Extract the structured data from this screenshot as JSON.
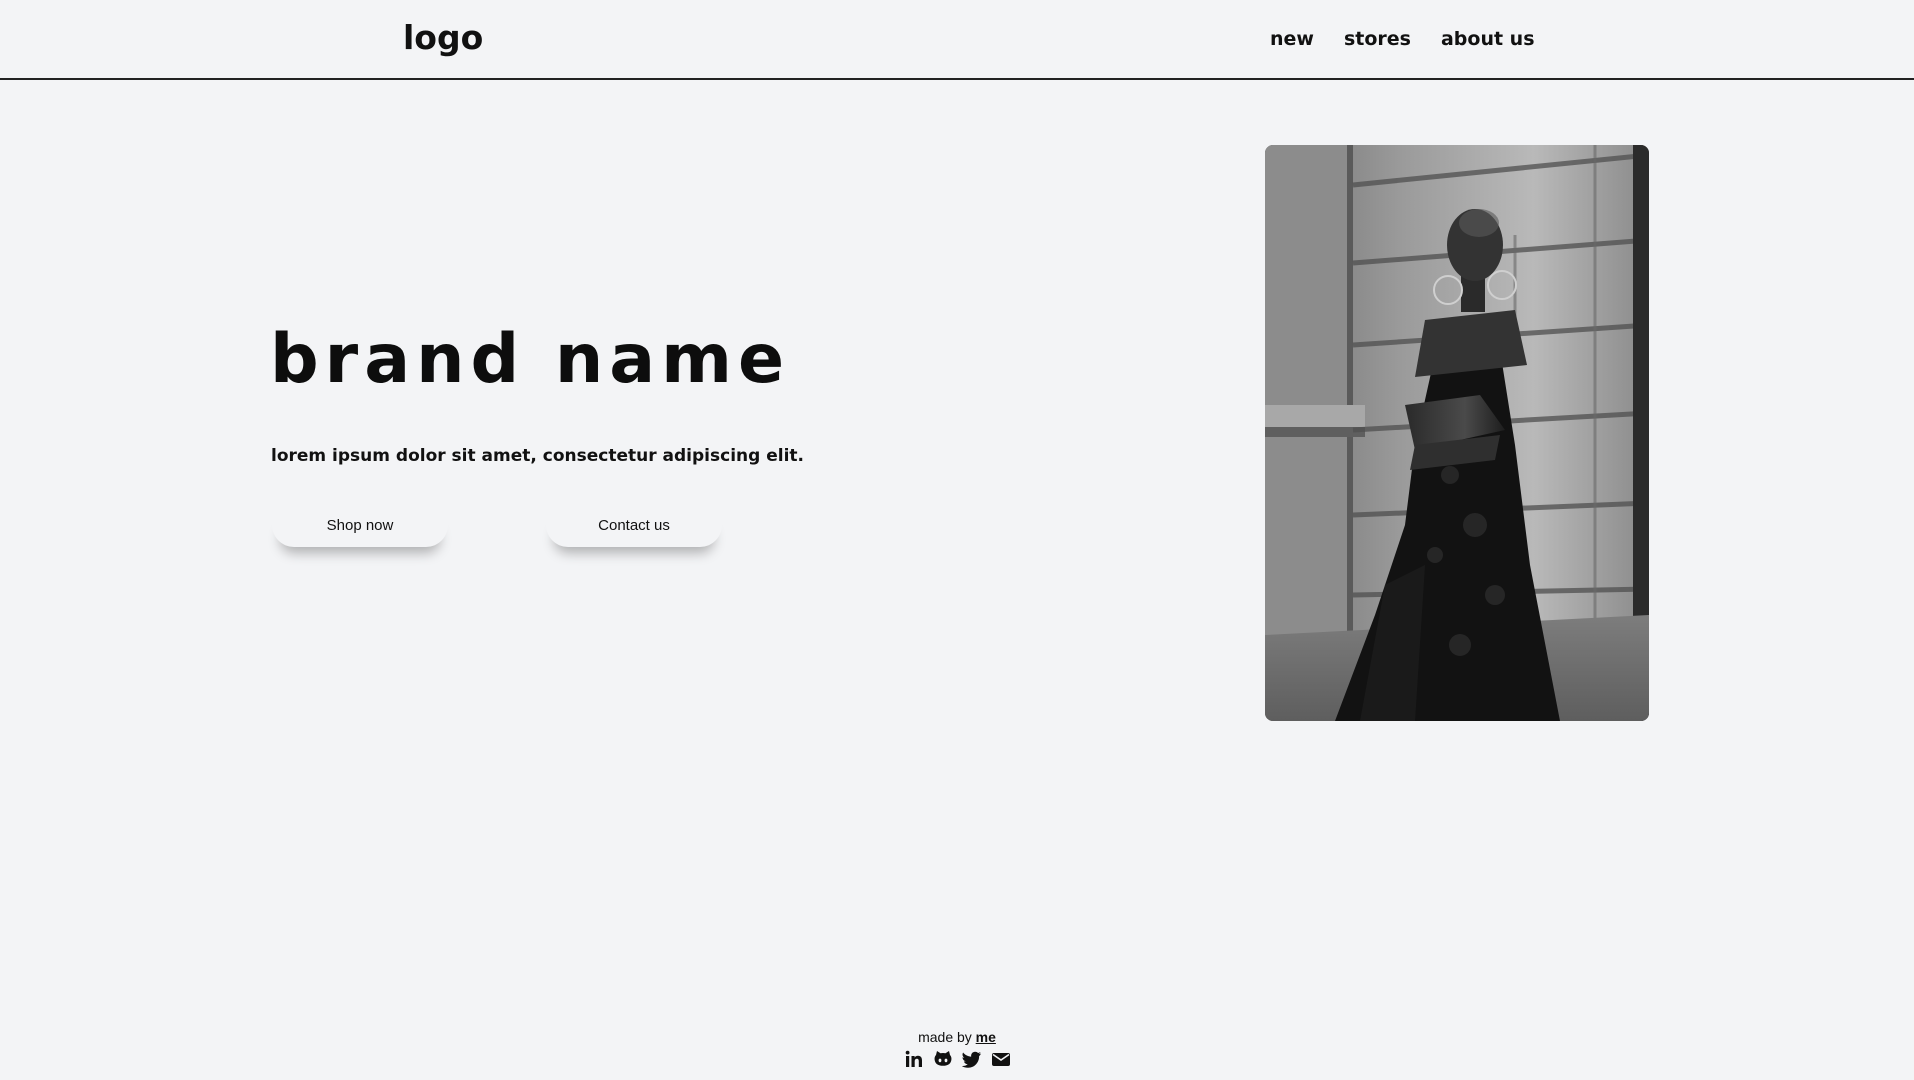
{
  "header": {
    "logo": "logo",
    "nav": [
      {
        "label": "new"
      },
      {
        "label": "stores"
      },
      {
        "label": "about us"
      }
    ]
  },
  "hero": {
    "title": "brand name",
    "tagline": "lorem ipsum dolor sit amet, consectetur adipiscing elit.",
    "buttons": {
      "shop": "Shop now",
      "contact": "Contact us"
    },
    "image_icon": "fashion-photo"
  },
  "footer": {
    "made_by_prefix": "made by ",
    "made_by_link": "me",
    "socials": [
      {
        "icon": "linkedin-icon"
      },
      {
        "icon": "github-icon"
      },
      {
        "icon": "twitter-icon"
      },
      {
        "icon": "email-icon"
      }
    ]
  },
  "colors": {
    "background": "#f3f4f6",
    "text": "#111111",
    "divider": "#222222"
  }
}
